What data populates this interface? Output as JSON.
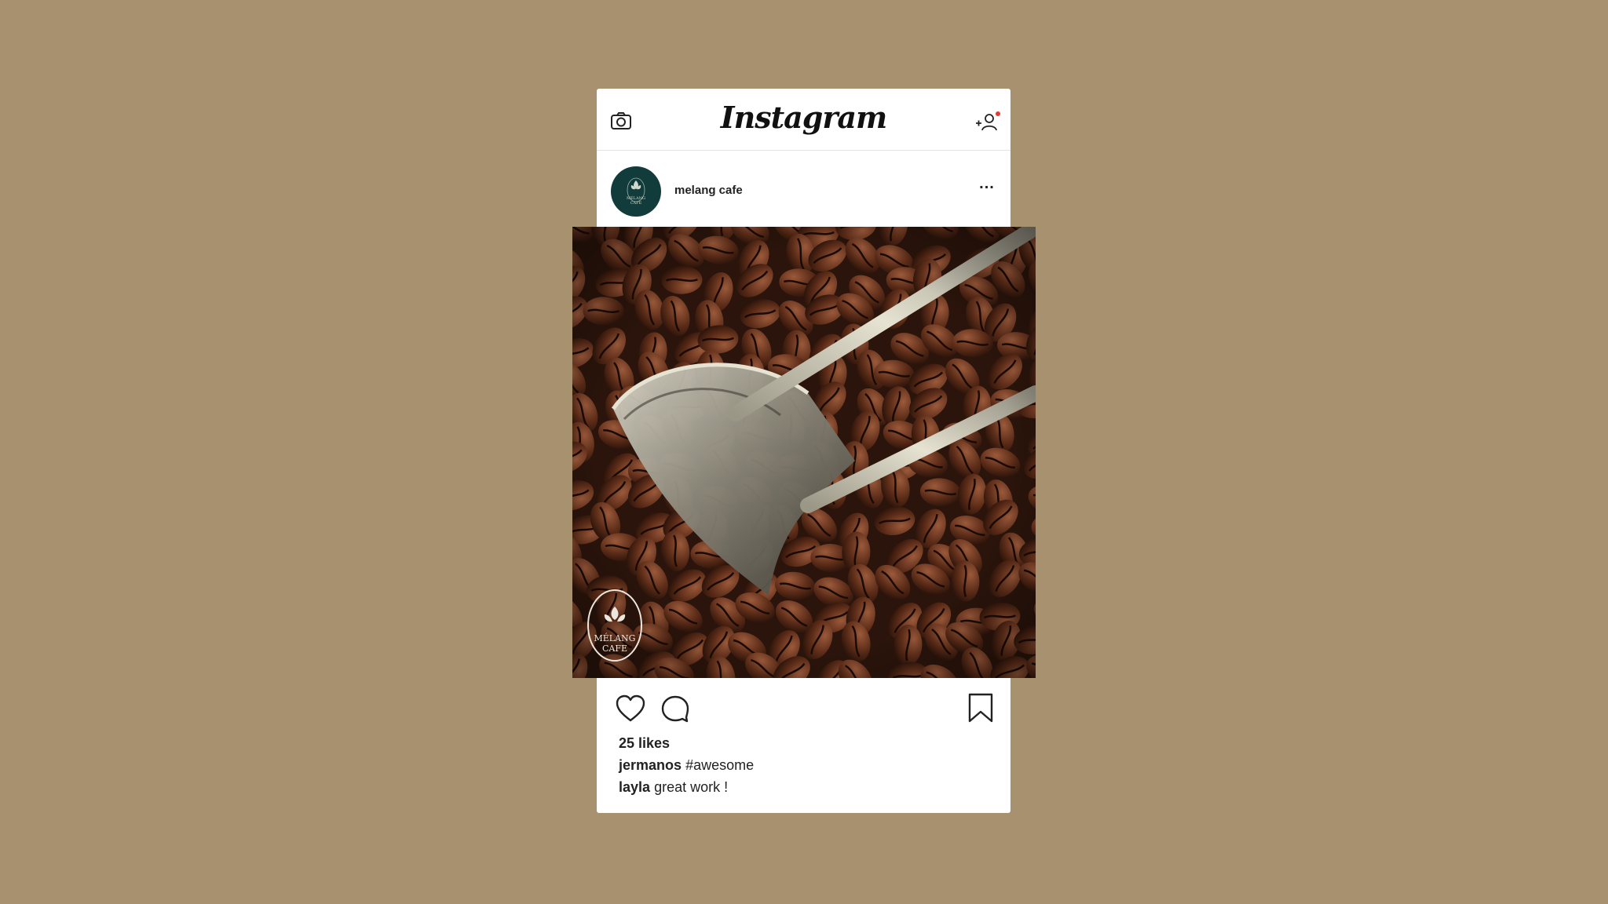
{
  "app": {
    "brand": "Instagram"
  },
  "colors": {
    "background": "#a8916f",
    "card": "#ffffff",
    "avatar_bg": "#123b3b",
    "notification": "#e53935"
  },
  "topbar": {
    "left_icon": "camera-icon",
    "right_icon": "add-user-icon"
  },
  "post": {
    "username": "melang cafe",
    "avatar_text": [
      "MÉLANG",
      "CAFE"
    ],
    "more_label": "...",
    "image_watermark": [
      "MÉLANG",
      "CAFE"
    ],
    "likes": "25 likes",
    "comments": [
      {
        "user": "jermanos",
        "text": "#awesome"
      },
      {
        "user": "layla",
        "text": "great work !"
      }
    ]
  },
  "icons": [
    "heart-icon",
    "comment-icon",
    "bookmark-icon"
  ]
}
